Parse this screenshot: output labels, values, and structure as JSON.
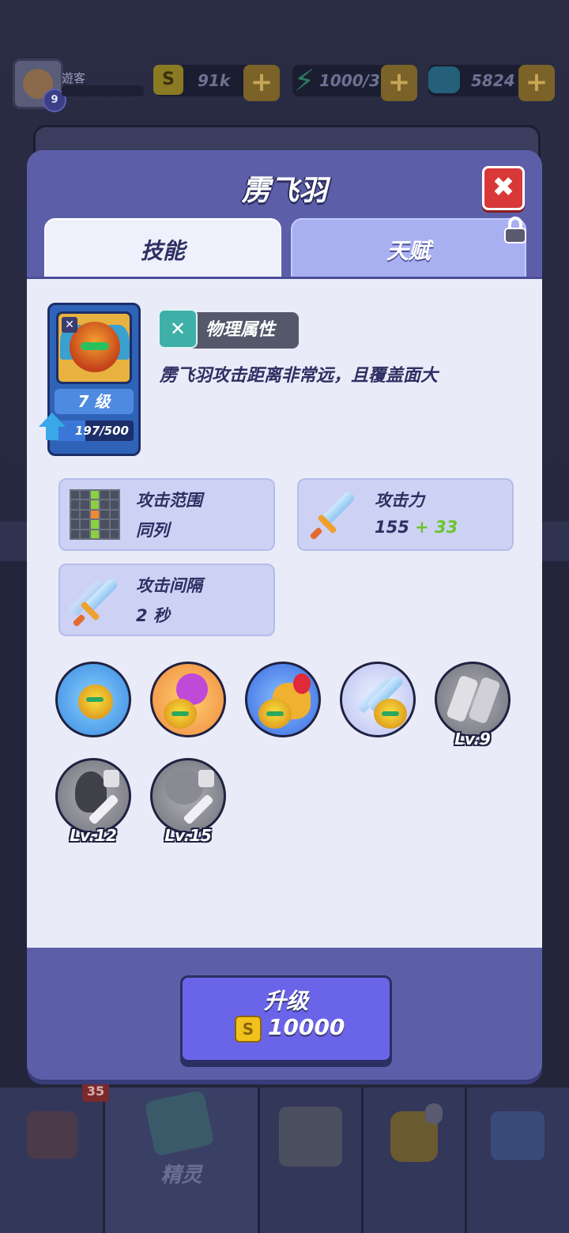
{
  "header": {
    "username": "遊客",
    "player_level": "9",
    "coins": "91k",
    "energy": "1000/3",
    "gems": "5824"
  },
  "dialog": {
    "title": "雳飞羽",
    "close_icon": "✖",
    "tabs": [
      {
        "label": "技能",
        "active": true
      },
      {
        "label": "天赋",
        "active": false,
        "locked": true
      }
    ]
  },
  "hero": {
    "level_label": "7 级",
    "xp_text": "197/500",
    "xp_progress": 0.394,
    "attribute": "物理属性",
    "description": "雳飞羽攻击距离非常远，且覆盖面大"
  },
  "stats": {
    "range": {
      "label": "攻击范围",
      "value": "同列"
    },
    "attack": {
      "label": "攻击力",
      "base": "155",
      "bonus": "+ 33"
    },
    "interval": {
      "label": "攻击间隔",
      "value": "2 秒"
    }
  },
  "skills": [
    {
      "icon": "hero-skill-icon",
      "locked": false,
      "level": ""
    },
    {
      "icon": "bomb-skill-icon",
      "locked": false,
      "level": ""
    },
    {
      "icon": "coin-bag-skill-icon",
      "locked": false,
      "level": ""
    },
    {
      "icon": "double-sword-skill-icon",
      "locked": false,
      "level": ""
    },
    {
      "icon": "crystal-skill-icon",
      "locked": true,
      "level": "Lv.9"
    },
    {
      "icon": "shield-up-skill-icon",
      "locked": true,
      "level": "Lv.12"
    },
    {
      "icon": "skull-up-skill-icon",
      "locked": true,
      "level": "Lv.15"
    }
  ],
  "upgrade": {
    "label": "升级",
    "cost": "10000"
  },
  "bottom_nav": {
    "badge": "35",
    "active_label": "精灵"
  },
  "colors": {
    "modal": "#5c5fa8",
    "panel": "#e9ebf8",
    "close": "#d93838",
    "upgrade": "#6a64e8",
    "bonus": "#6bc42a"
  }
}
